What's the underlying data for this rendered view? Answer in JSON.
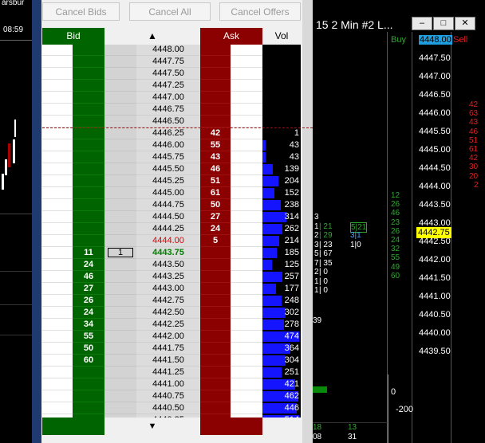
{
  "toolbar": {
    "cancel_bids": "Cancel Bids",
    "cancel_all": "Cancel All",
    "cancel_offers": "Cancel Offers"
  },
  "headers": {
    "bid": "Bid",
    "ask": "Ask",
    "vol": "Vol",
    "scroll_up": "▲",
    "scroll_down": "▼"
  },
  "left_strip": {
    "label": "arsbur",
    "time": "08:59"
  },
  "ladder": [
    {
      "price": "4448.00",
      "bid": "",
      "ask": "",
      "vol": "",
      "volfrac": 0
    },
    {
      "price": "4447.75",
      "bid": "",
      "ask": "",
      "vol": "",
      "volfrac": 0
    },
    {
      "price": "4447.50",
      "bid": "",
      "ask": "",
      "vol": "",
      "volfrac": 0
    },
    {
      "price": "4447.25",
      "bid": "",
      "ask": "",
      "vol": "",
      "volfrac": 0
    },
    {
      "price": "4447.00",
      "bid": "",
      "ask": "",
      "vol": "",
      "volfrac": 0
    },
    {
      "price": "4446.75",
      "bid": "",
      "ask": "",
      "vol": "",
      "volfrac": 0
    },
    {
      "price": "4446.50",
      "bid": "",
      "ask": "",
      "vol": "",
      "volfrac": 0
    },
    {
      "price": "4446.25",
      "bid": "",
      "ask": "42",
      "vol": "1",
      "volfrac": 0.0
    },
    {
      "price": "4446.00",
      "bid": "",
      "ask": "55",
      "vol": "43",
      "volfrac": 0.09
    },
    {
      "price": "4445.75",
      "bid": "",
      "ask": "43",
      "vol": "43",
      "volfrac": 0.09
    },
    {
      "price": "4445.50",
      "bid": "",
      "ask": "46",
      "vol": "139",
      "volfrac": 0.29
    },
    {
      "price": "4445.25",
      "bid": "",
      "ask": "51",
      "vol": "204",
      "volfrac": 0.43
    },
    {
      "price": "4445.00",
      "bid": "",
      "ask": "61",
      "vol": "152",
      "volfrac": 0.32
    },
    {
      "price": "4444.75",
      "bid": "",
      "ask": "50",
      "vol": "238",
      "volfrac": 0.5
    },
    {
      "price": "4444.50",
      "bid": "",
      "ask": "27",
      "vol": "314",
      "volfrac": 0.66
    },
    {
      "price": "4444.25",
      "bid": "",
      "ask": "24",
      "vol": "262",
      "volfrac": 0.55
    },
    {
      "price": "4444.00",
      "bid": "",
      "ask": "5",
      "vol": "214",
      "volfrac": 0.45,
      "price_style": "last"
    },
    {
      "price": "4443.75",
      "bid": "11",
      "ask": "",
      "vol": "185",
      "volfrac": 0.39,
      "price_style": "current",
      "mid": "1"
    },
    {
      "price": "4443.50",
      "bid": "24",
      "ask": "",
      "vol": "125",
      "volfrac": 0.26
    },
    {
      "price": "4443.25",
      "bid": "46",
      "ask": "",
      "vol": "257",
      "volfrac": 0.54
    },
    {
      "price": "4443.00",
      "bid": "27",
      "ask": "",
      "vol": "177",
      "volfrac": 0.37
    },
    {
      "price": "4442.75",
      "bid": "26",
      "ask": "",
      "vol": "248",
      "volfrac": 0.52
    },
    {
      "price": "4442.50",
      "bid": "24",
      "ask": "",
      "vol": "302",
      "volfrac": 0.64
    },
    {
      "price": "4442.25",
      "bid": "34",
      "ask": "",
      "vol": "278",
      "volfrac": 0.59
    },
    {
      "price": "4442.00",
      "bid": "55",
      "ask": "",
      "vol": "474",
      "volfrac": 1.0
    },
    {
      "price": "4441.75",
      "bid": "50",
      "ask": "",
      "vol": "364",
      "volfrac": 0.77
    },
    {
      "price": "4441.50",
      "bid": "60",
      "ask": "",
      "vol": "304",
      "volfrac": 0.64
    },
    {
      "price": "4441.25",
      "bid": "",
      "ask": "",
      "vol": "251",
      "volfrac": 0.53
    },
    {
      "price": "4441.00",
      "bid": "",
      "ask": "",
      "vol": "421",
      "volfrac": 0.89
    },
    {
      "price": "4440.75",
      "bid": "",
      "ask": "",
      "vol": "462",
      "volfrac": 0.97
    },
    {
      "price": "4440.50",
      "bid": "",
      "ask": "",
      "vol": "446",
      "volfrac": 0.94
    },
    {
      "price": "4440.25",
      "bid": "",
      "ask": "",
      "vol": "514",
      "volfrac": 1.0
    }
  ],
  "chart": {
    "title": "15  2 Min  #2  L...",
    "buy_label": "Buy",
    "sell_label": "Sell",
    "current_price": "4448.00",
    "last_price": "4442.75",
    "price_axis": [
      "4447.50",
      "4447.00",
      "4446.50",
      "4446.00",
      "4445.50",
      "4445.00",
      "4444.50",
      "4444.00",
      "4443.50",
      "4443.00",
      "4442.50",
      "4442.00",
      "4441.50",
      "4441.00",
      "4440.50",
      "4440.00",
      "4439.50"
    ],
    "buy_values": [
      "12",
      "26",
      "46",
      "23",
      "26",
      "24",
      "32",
      "55",
      "49",
      "60"
    ],
    "sell_values": [
      "42",
      "63",
      "43",
      "46",
      "51",
      "61",
      "42",
      "30",
      "20",
      "2"
    ],
    "footprint": [
      {
        "left": "3",
        "right": ""
      },
      {
        "left": "1",
        "right": "21",
        "r2": "5|21"
      },
      {
        "left": "2",
        "right": "29",
        "r2": "3|1"
      },
      {
        "left": "3",
        "right": "23",
        "r2": "1|0"
      },
      {
        "left": "5",
        "right": "67"
      },
      {
        "left": "7",
        "right": "35"
      },
      {
        "left": "2",
        "right": "0"
      },
      {
        "left": "1",
        "right": "0"
      },
      {
        "left": "1",
        "right": "0"
      }
    ],
    "footprint_extra": "39",
    "axis_zero": "0",
    "axis_neg": "-200",
    "bottom_vals": [
      "18",
      "13",
      "08",
      "31"
    ],
    "win_min": "–",
    "win_max": "□",
    "win_close": "✕"
  },
  "colors": {
    "bid": "#006400",
    "ask": "#8b0000",
    "vol_bar": "#1414ff",
    "buy": "#2ea82e",
    "sell": "#e02020"
  }
}
